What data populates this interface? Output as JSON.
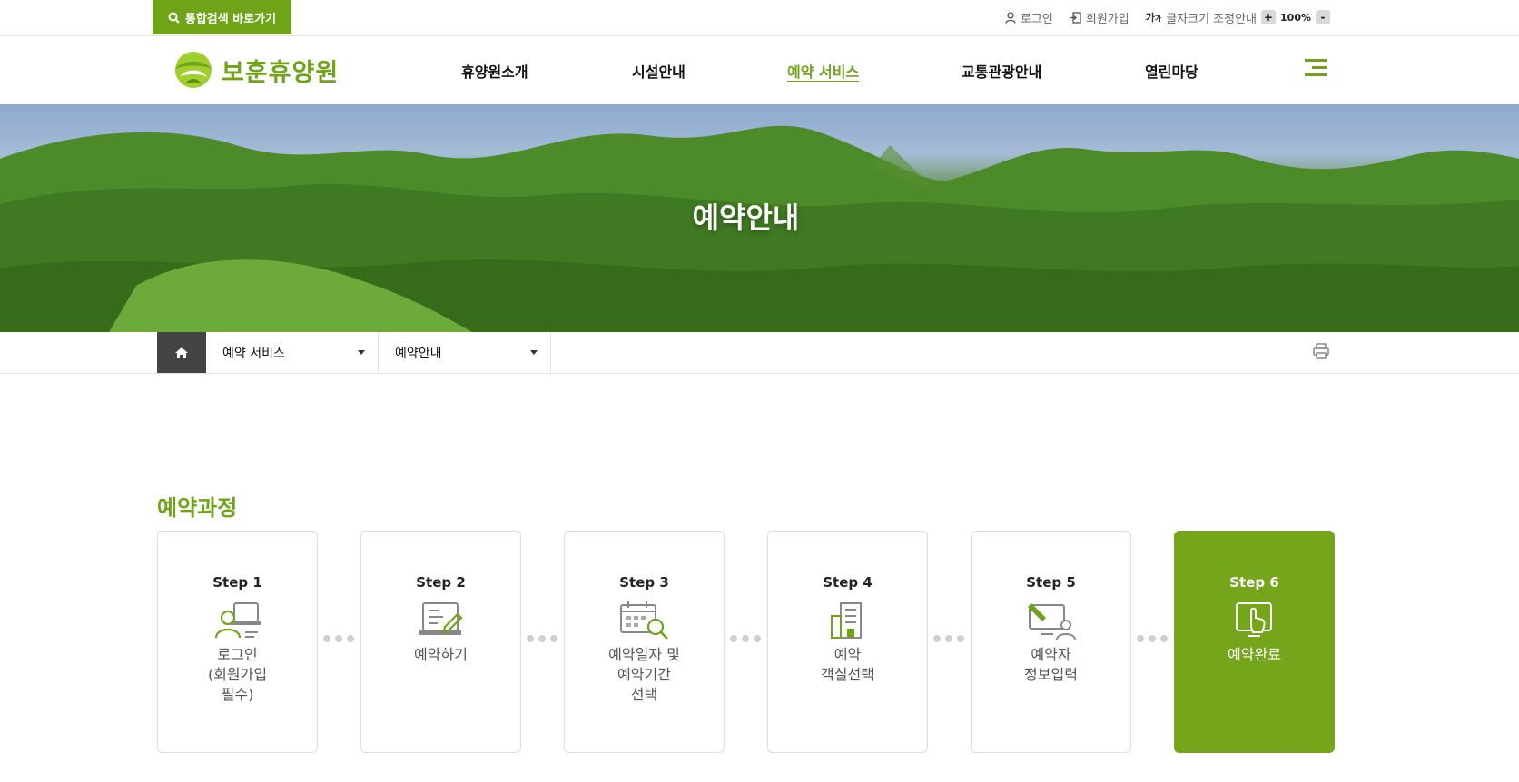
{
  "topbar": {
    "search_shortcut": "통합검색 바로가기",
    "login": "로그인",
    "signup": "회원가입",
    "font_size_label": "글자크기 조정안내",
    "font_plus": "+",
    "font_minus": "-",
    "zoom": "100%"
  },
  "header": {
    "logo_text": "보훈휴양원",
    "menu": [
      "휴양원소개",
      "시설안내",
      "예약 서비스",
      "교통관광안내",
      "열린마당"
    ],
    "active_menu": "예약 서비스"
  },
  "hero": {
    "title": "예약안내"
  },
  "breadcrumb": {
    "depth1": "예약 서비스",
    "depth2": "예약안내"
  },
  "section": {
    "title": "예약과정",
    "steps": [
      {
        "num": "Step 1",
        "label": "로그인\n(회원가입\n필수)",
        "icon": "login-person-icon"
      },
      {
        "num": "Step 2",
        "label": "예약하기",
        "icon": "reservation-form-icon"
      },
      {
        "num": "Step 3",
        "label": "예약일자 및\n예약기간\n선택",
        "icon": "calendar-search-icon"
      },
      {
        "num": "Step 4",
        "label": "예약\n객실선택",
        "icon": "building-icon"
      },
      {
        "num": "Step 5",
        "label": "예약자\n정보입력",
        "icon": "monitor-person-icon"
      },
      {
        "num": "Step 6",
        "label": "예약완료",
        "icon": "touch-screen-icon"
      }
    ]
  },
  "colors": {
    "brand_green": "#6fa318",
    "active_step": "#74a51b",
    "dark_home": "#444444"
  }
}
